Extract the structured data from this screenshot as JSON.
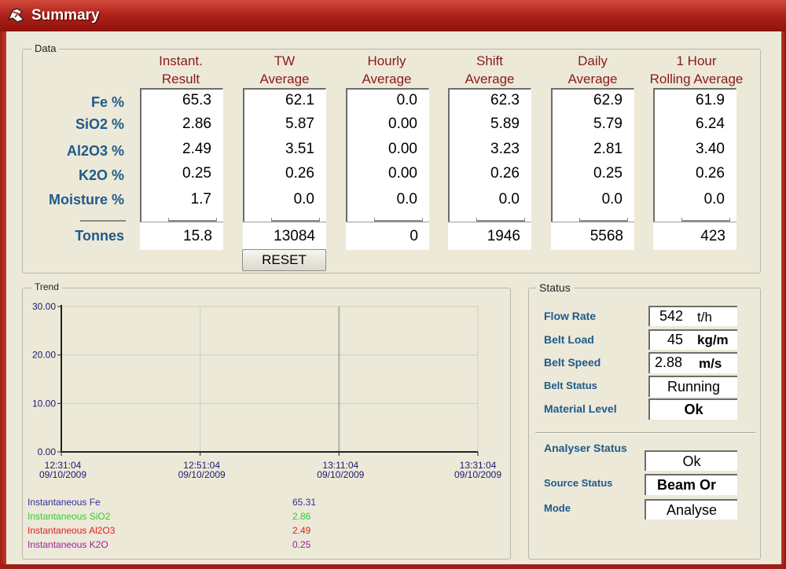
{
  "window": {
    "title": "Summary"
  },
  "data_panel": {
    "label": "Data",
    "columns": [
      {
        "line1": "Instant.",
        "line2": "Result",
        "values": [
          "65.3",
          "2.86",
          "2.49",
          "0.25",
          "1.7"
        ],
        "tonnes": "15.8"
      },
      {
        "line1": "TW",
        "line2": "Average",
        "values": [
          "62.1",
          "5.87",
          "3.51",
          "0.26",
          "0.0"
        ],
        "tonnes": "13084"
      },
      {
        "line1": "Hourly",
        "line2": "Average",
        "values": [
          "0.0",
          "0.00",
          "0.00",
          "0.00",
          "0.0"
        ],
        "tonnes": "0"
      },
      {
        "line1": "Shift",
        "line2": "Average",
        "values": [
          "62.3",
          "5.89",
          "3.23",
          "0.26",
          "0.0"
        ],
        "tonnes": "1946"
      },
      {
        "line1": "Daily",
        "line2": "Average",
        "values": [
          "62.9",
          "5.79",
          "2.81",
          "0.25",
          "0.0"
        ],
        "tonnes": "5568"
      },
      {
        "line1": "1 Hour",
        "line2": "Rolling Average",
        "values": [
          "61.9",
          "6.24",
          "3.40",
          "0.26",
          "0.0"
        ],
        "tonnes": "423"
      }
    ],
    "row_labels": [
      "Fe %",
      "SiO2 %",
      "Al2O3 %",
      "K2O %",
      "Moisture %"
    ],
    "tonnes_label": "Tonnes",
    "reset_label": "RESET"
  },
  "trend_panel": {
    "label": "Trend",
    "legend": [
      {
        "name": "Instantaneous Fe",
        "value": "65.31",
        "color": "#3030a0"
      },
      {
        "name": "Instantaneous SiO2",
        "value": "2.86",
        "color": "#33cc33"
      },
      {
        "name": "Instantaneous Al2O3",
        "value": "2.49",
        "color": "#e02020"
      },
      {
        "name": "Instantaneous K2O",
        "value": "0.25",
        "color": "#a020a0"
      }
    ]
  },
  "chart_data": {
    "type": "line",
    "ylim": [
      0,
      30
    ],
    "y_ticks": [
      "0.00",
      "10.00",
      "20.00",
      "30.00"
    ],
    "x_ticks": [
      {
        "time": "12:31:04",
        "date": "09/10/2009"
      },
      {
        "time": "12:51:04",
        "date": "09/10/2009"
      },
      {
        "time": "13:11:04",
        "date": "09/10/2009"
      },
      {
        "time": "13:31:04",
        "date": "09/10/2009"
      }
    ],
    "grid": true,
    "series": []
  },
  "status_panel": {
    "label": "Status",
    "flow_rate": {
      "label": "Flow Rate",
      "value": "542",
      "unit": "t/h"
    },
    "belt_load": {
      "label": "Belt Load",
      "value": "45",
      "unit": "kg/m"
    },
    "belt_speed": {
      "label": "Belt Speed",
      "value": "2.88",
      "unit": "m/s"
    },
    "belt_status": {
      "label": "Belt Status",
      "value": "Running"
    },
    "material_level": {
      "label": "Material Level",
      "value": "Ok"
    },
    "analyser_status": {
      "label": "Analyser Status",
      "value": "Ok"
    },
    "source_status": {
      "label": "Source Status",
      "value": "Beam Or"
    },
    "mode": {
      "label": "Mode",
      "value": "Analyse"
    }
  },
  "colors": {
    "title_bar": "#b0231b",
    "label_blue": "#1f5a8a",
    "header_red": "#8b1a1a"
  }
}
